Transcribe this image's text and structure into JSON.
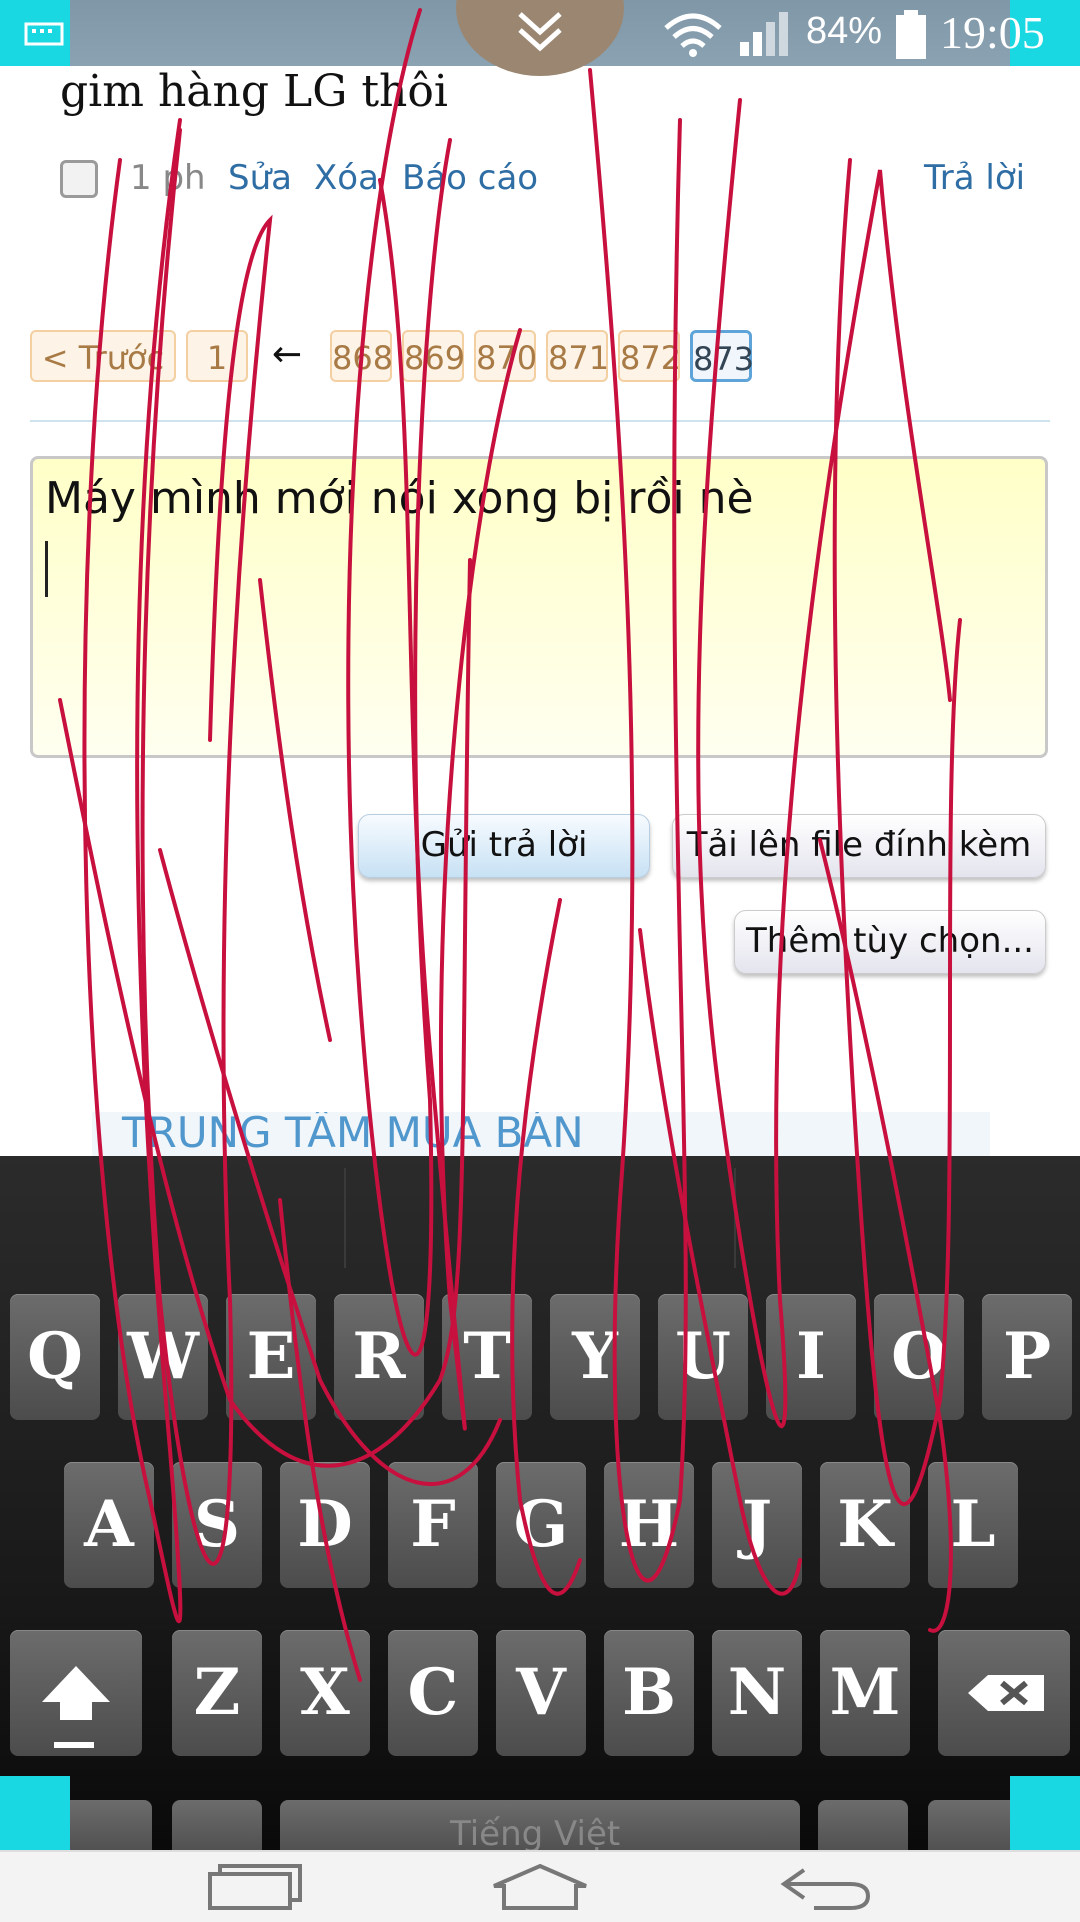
{
  "status_bar": {
    "battery_percent": "84%",
    "time": "19:05",
    "icons": [
      "keyboard-icon",
      "collapse-chevron-icon",
      "wifi-icon",
      "signal-icon",
      "battery-icon"
    ]
  },
  "post": {
    "text": "gim hàng LG thôi",
    "time": "1 ph",
    "edit": "Sửa",
    "delete": "Xóa",
    "report": "Báo cáo",
    "reply": "Trả lời"
  },
  "pagination": {
    "prev": "< Trước",
    "first": "1",
    "arrow": "←",
    "pages": [
      "868",
      "869",
      "870",
      "871",
      "872",
      "873"
    ],
    "current": "873"
  },
  "editor": {
    "value": "Máy mình mới nói xong bị rồi nè"
  },
  "buttons": {
    "send": "Gửi trả lời",
    "upload": "Tải lên file đính kèm",
    "more": "Thêm tùy chọn..."
  },
  "section": {
    "title": "TRUNG TÂM MUA BÁN"
  },
  "keyboard": {
    "row1": [
      "Q",
      "W",
      "E",
      "R",
      "T",
      "Y",
      "U",
      "I",
      "O",
      "P"
    ],
    "row2": [
      "A",
      "S",
      "D",
      "F",
      "G",
      "H",
      "J",
      "K",
      "L"
    ],
    "row3": [
      "Z",
      "X",
      "C",
      "V",
      "B",
      "N",
      "M"
    ],
    "space_label": "Tiếng Việt"
  },
  "colors": {
    "status_bar": "#8aa2b2",
    "corner_accent": "#19d8e1",
    "link": "#2f6ea5",
    "scribble": "#c8103e"
  }
}
